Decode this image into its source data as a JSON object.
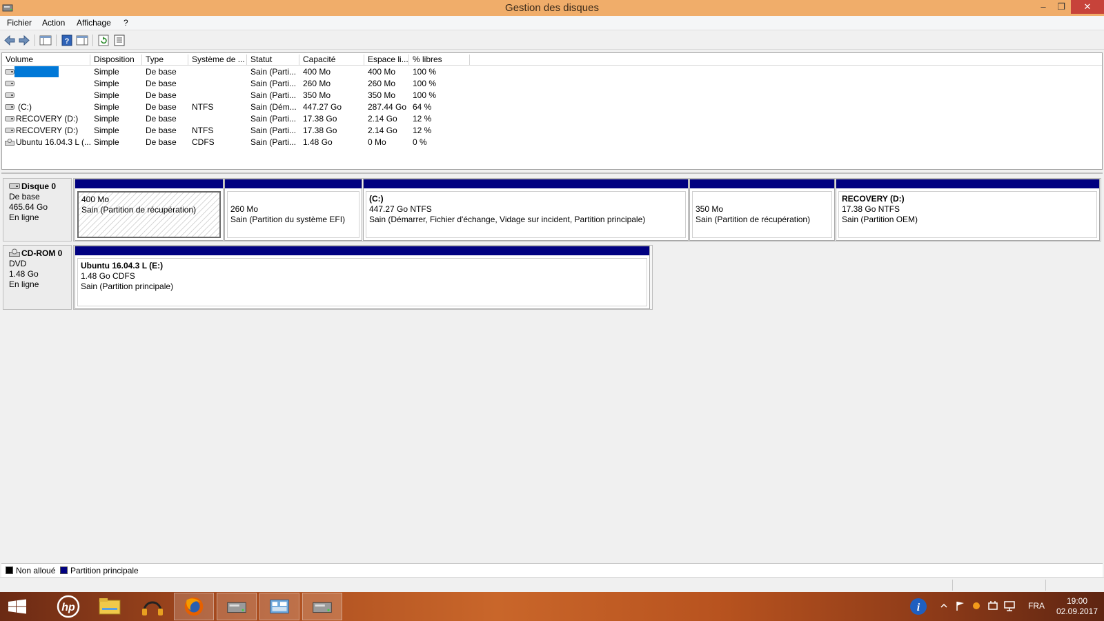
{
  "window": {
    "title": "Gestion des disques"
  },
  "menu": [
    "Fichier",
    "Action",
    "Affichage",
    "?"
  ],
  "window_controls": {
    "minimize": "‒",
    "maximize": "❐",
    "close": "✕"
  },
  "volume_list": {
    "columns": [
      "Volume",
      "Disposition",
      "Type",
      "Système de ...",
      "Statut",
      "Capacité",
      "Espace li...",
      "% libres"
    ],
    "rows": [
      {
        "volume": "",
        "disposition": "Simple",
        "type": "De base",
        "fs": "",
        "status": "Sain (Parti...",
        "capacity": "400 Mo",
        "free": "400 Mo",
        "pct": "100 %"
      },
      {
        "volume": "",
        "disposition": "Simple",
        "type": "De base",
        "fs": "",
        "status": "Sain (Parti...",
        "capacity": "260 Mo",
        "free": "260 Mo",
        "pct": "100 %"
      },
      {
        "volume": "",
        "disposition": "Simple",
        "type": "De base",
        "fs": "",
        "status": "Sain (Parti...",
        "capacity": "350 Mo",
        "free": "350 Mo",
        "pct": "100 %"
      },
      {
        "volume": "(C:)",
        "disposition": "Simple",
        "type": "De base",
        "fs": "NTFS",
        "status": "Sain (Dém...",
        "capacity": "447.27 Go",
        "free": "287.44 Go",
        "pct": "64 %"
      },
      {
        "volume": "RECOVERY (D:)",
        "disposition": "Simple",
        "type": "De base",
        "fs": "",
        "status": "Sain (Parti...",
        "capacity": "17.38 Go",
        "free": "2.14 Go",
        "pct": "12 %"
      },
      {
        "volume": "RECOVERY (D:)",
        "disposition": "Simple",
        "type": "De base",
        "fs": "NTFS",
        "status": "Sain (Parti...",
        "capacity": "17.38 Go",
        "free": "2.14 Go",
        "pct": "12 %"
      },
      {
        "volume": "Ubuntu 16.04.3 L (...",
        "disposition": "Simple",
        "type": "De base",
        "fs": "CDFS",
        "status": "Sain (Parti...",
        "capacity": "1.48 Go",
        "free": "0 Mo",
        "pct": "0 %"
      }
    ]
  },
  "disks": [
    {
      "name": "Disque 0",
      "kind": "De base",
      "size": "465.64 Go",
      "state": "En ligne",
      "partitions": [
        {
          "name": "",
          "line1": "400 Mo",
          "line2": "Sain (Partition de récupération)"
        },
        {
          "name": "",
          "line1": "260 Mo",
          "line2": "Sain (Partition du système EFI)"
        },
        {
          "name": "(C:)",
          "line1": "447.27 Go NTFS",
          "line2": "Sain (Démarrer, Fichier d'échange, Vidage sur incident, Partition principale)"
        },
        {
          "name": "",
          "line1": "350 Mo",
          "line2": "Sain (Partition de récupération)"
        },
        {
          "name": "RECOVERY  (D:)",
          "line1": "17.38 Go NTFS",
          "line2": "Sain (Partition OEM)"
        }
      ]
    },
    {
      "name": "CD-ROM 0",
      "kind": "DVD",
      "size": "1.48 Go",
      "state": "En ligne",
      "partitions": [
        {
          "name": "Ubuntu 16.04.3 L  (E:)",
          "line1": "1.48 Go CDFS",
          "line2": "Sain (Partition principale)"
        }
      ]
    }
  ],
  "legend": [
    {
      "label": "Non alloué",
      "color": "#000000"
    },
    {
      "label": "Partition principale",
      "color": "#000080"
    }
  ],
  "taskbar": {
    "apps": [
      "start-icon",
      "hp-icon",
      "file-explorer-icon",
      "headphones-icon",
      "firefox-icon",
      "disk-management-icon",
      "network-icon",
      "disk-management-icon"
    ],
    "language": "FRA",
    "time": "19:00",
    "date": "02.09.2017"
  }
}
